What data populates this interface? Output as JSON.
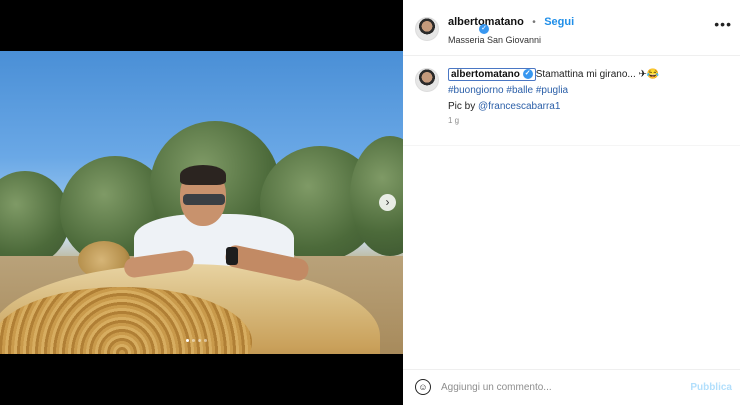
{
  "post": {
    "author": "albertomatano",
    "follow_label": "Segui",
    "location": "Masseria San Giovanni",
    "more_label": "•••",
    "caption_text": "Stamattina mi girano... ✈😂",
    "hashtags": "#buongiorno #balle #puglia",
    "credit_prefix": "Pic by ",
    "credit_handle": "@francescabarra1",
    "time_ago": "1 g"
  },
  "comment": {
    "placeholder": "Aggiungi un commento...",
    "publish_label": "Pubblica"
  },
  "carousel": {
    "next_glyph": "›",
    "slides": 4,
    "active_slide": 1
  },
  "colors": {
    "link": "#1f8ee8",
    "hashtag": "#2b5fa8",
    "verified": "#3897f0"
  }
}
